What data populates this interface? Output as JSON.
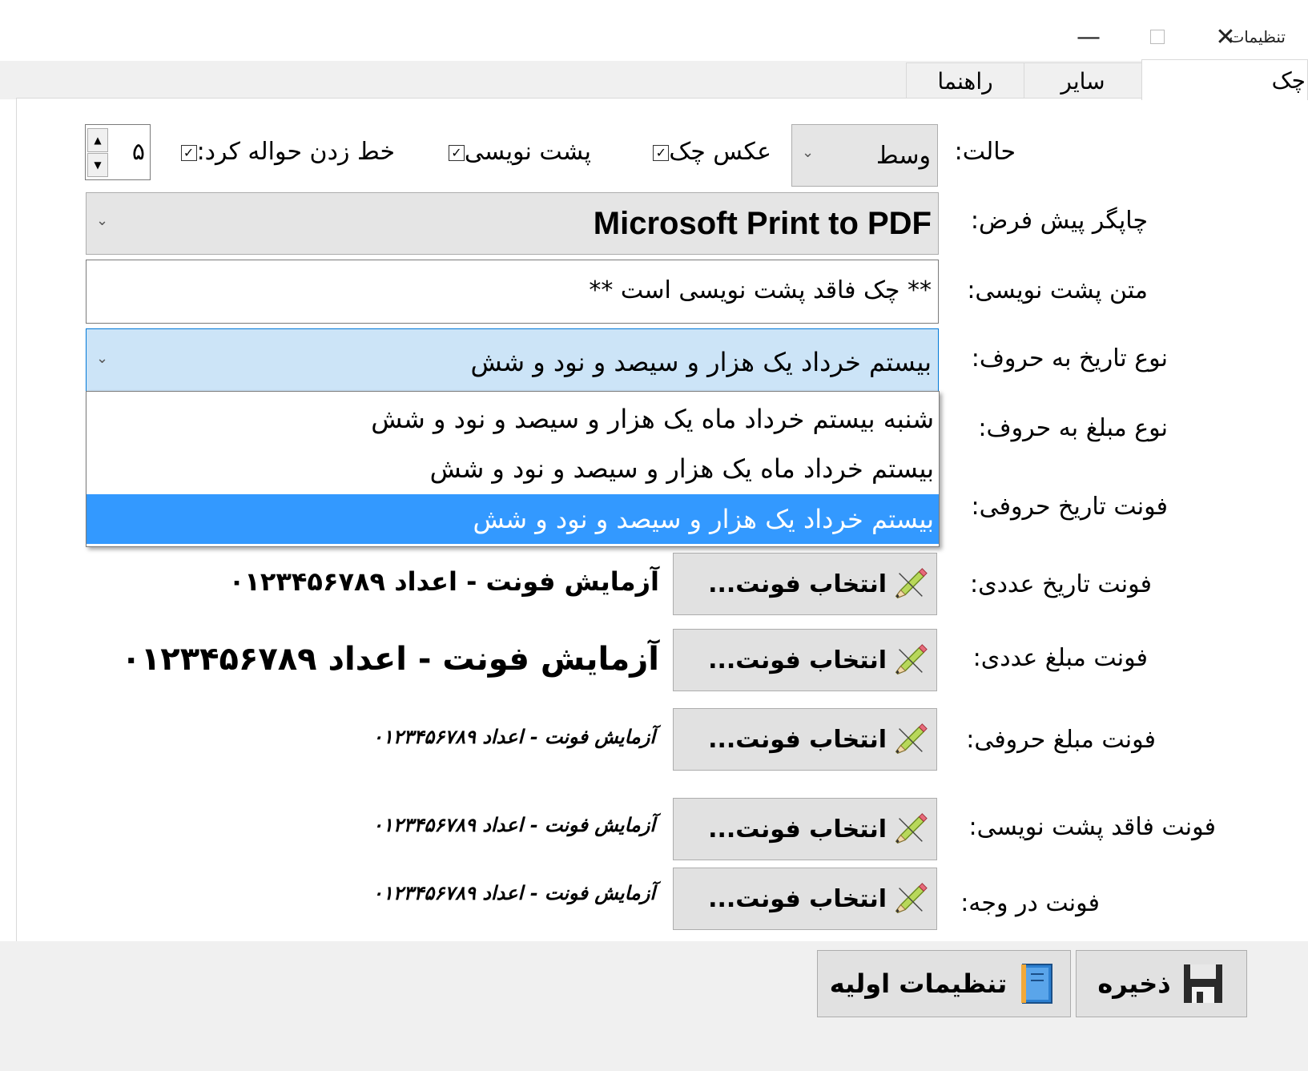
{
  "window": {
    "title": "تنظیمات",
    "minimize_icon": "minimize-icon",
    "maximize_icon": "maximize-icon",
    "close_icon": "close-icon"
  },
  "tabs": [
    {
      "label": "چک",
      "active": true
    },
    {
      "label": "سایر",
      "active": false
    },
    {
      "label": "راهنما",
      "active": false
    }
  ],
  "mode": {
    "label": "حالت:",
    "value": "وسط"
  },
  "checks": {
    "photo": {
      "label": "عکس چک",
      "checked": true
    },
    "back": {
      "label": "پشت نویسی",
      "checked": true
    },
    "strike": {
      "label": "خط زدن حواله کرد:",
      "checked": true
    }
  },
  "strike_value": "۵",
  "printer": {
    "label": "چاپگر پیش فرض:",
    "value": "Microsoft Print to PDF"
  },
  "endorse": {
    "label": "متن پشت نویسی:",
    "value": "** چک فاقد پشت نویسی است **"
  },
  "date_words": {
    "label": "نوع تاریخ به حروف:",
    "value": "بیستم خرداد یک هزار و سیصد و نود و شش",
    "options": [
      "شنبه بیستم خرداد ماه یک هزار و سیصد و نود و شش",
      "بیستم خرداد ماه یک هزار و سیصد و نود و شش",
      "بیستم خرداد یک هزار و سیصد و نود و شش"
    ],
    "selected_index": 2
  },
  "amount_words_label": "نوع مبلغ به حروف:",
  "date_font_words_label": "فونت تاریخ حروفی:",
  "font_button_label": "انتخاب فونت...",
  "font_rows": [
    {
      "label": "فونت تاریخ عددی:",
      "sample": "آزمایش فونت - اعداد ۰۱۲۳۴۵۶۷۸۹"
    },
    {
      "label": "فونت مبلغ عددی:",
      "sample": "آزمایش فونت - اعداد ۰۱۲۳۴۵۶۷۸۹"
    },
    {
      "label": "فونت مبلغ حروفی:",
      "sample": "آزمایش فونت - اعداد ۰۱۲۳۴۵۶۷۸۹"
    },
    {
      "label": "فونت فاقد پشت نویسی:",
      "sample": "آزمایش فونت - اعداد ۰۱۲۳۴۵۶۷۸۹"
    },
    {
      "label": "فونت در وجه:",
      "sample": "آزمایش فونت - اعداد ۰۱۲۳۴۵۶۷۸۹"
    }
  ],
  "buttons": {
    "save": "ذخیره",
    "defaults": "تنظیمات اولیه"
  }
}
